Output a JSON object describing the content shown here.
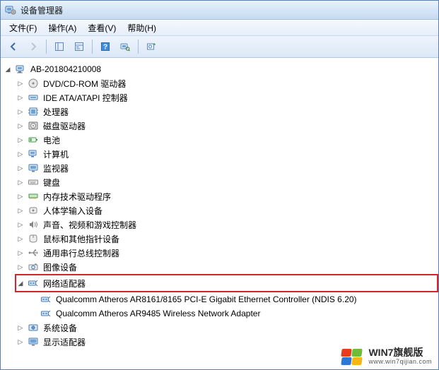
{
  "title": "设备管理器",
  "menus": {
    "file": "文件(F)",
    "action": "操作(A)",
    "view": "查看(V)",
    "help": "帮助(H)"
  },
  "root": {
    "label": "AB-201804210008"
  },
  "categories": [
    {
      "label": "DVD/CD-ROM 驱动器",
      "icon": "disc"
    },
    {
      "label": "IDE ATA/ATAPI 控制器",
      "icon": "ide"
    },
    {
      "label": "处理器",
      "icon": "cpu"
    },
    {
      "label": "磁盘驱动器",
      "icon": "hdd"
    },
    {
      "label": "电池",
      "icon": "battery"
    },
    {
      "label": "计算机",
      "icon": "computer"
    },
    {
      "label": "监视器",
      "icon": "monitor"
    },
    {
      "label": "键盘",
      "icon": "keyboard"
    },
    {
      "label": "内存技术驱动程序",
      "icon": "memory"
    },
    {
      "label": "人体学输入设备",
      "icon": "hid"
    },
    {
      "label": "声音、视频和游戏控制器",
      "icon": "sound"
    },
    {
      "label": "鼠标和其他指针设备",
      "icon": "mouse"
    },
    {
      "label": "通用串行总线控制器",
      "icon": "usb"
    },
    {
      "label": "图像设备",
      "icon": "camera"
    }
  ],
  "network": {
    "label": "网络适配器",
    "children": [
      "Qualcomm Atheros AR8161/8165 PCI-E Gigabit Ethernet Controller (NDIS 6.20)",
      "Qualcomm Atheros AR9485 Wireless Network Adapter"
    ]
  },
  "categories_after": [
    {
      "label": "系统设备",
      "icon": "system"
    },
    {
      "label": "显示适配器",
      "icon": "display"
    }
  ],
  "watermark": {
    "line1": "WIN7旗舰版",
    "line2": "www.win7qijian.com"
  }
}
